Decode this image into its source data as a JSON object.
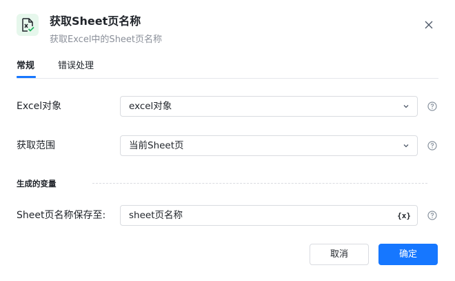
{
  "header": {
    "title": "获取Sheet页名称",
    "subtitle": "获取Excel中的Sheet页名称",
    "icon": "excel-sheet-icon",
    "accent": "#1677ff",
    "icon_bg": "#e6f7ec"
  },
  "tabs": [
    {
      "label": "常规",
      "active": true
    },
    {
      "label": "错误处理",
      "active": false
    }
  ],
  "form": {
    "excel_object": {
      "label": "Excel对象",
      "value": "excel对象"
    },
    "range": {
      "label": "获取范围",
      "value": "当前Sheet页"
    },
    "section_title": "生成的变量",
    "save_to": {
      "label": "Sheet页名称保存至:",
      "value": "sheet页名称",
      "suffix": "{x}"
    }
  },
  "footer": {
    "cancel_label": "取消",
    "ok_label": "确定"
  }
}
